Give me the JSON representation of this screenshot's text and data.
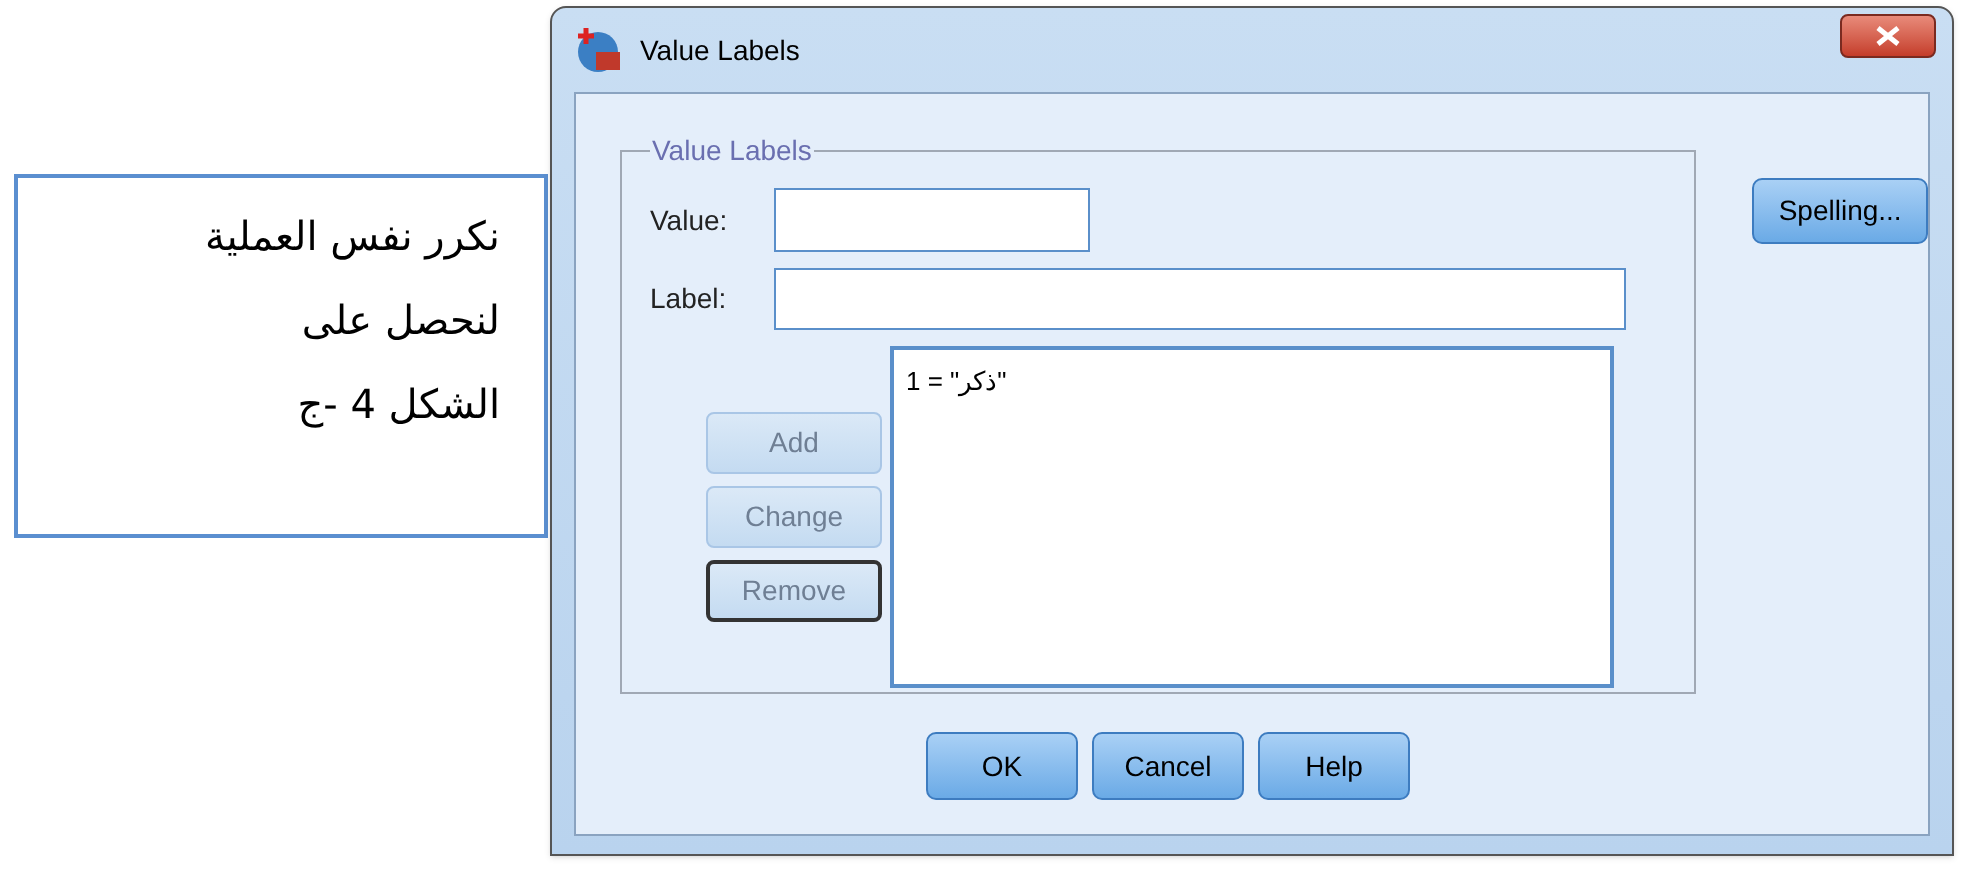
{
  "note": {
    "lines": [
      "نكرر نفس العملية",
      "لنحصل على",
      "الشكل 4 -ج"
    ]
  },
  "window": {
    "title": "Value Labels"
  },
  "group": {
    "title": "Value Labels",
    "value_field": {
      "label": "Value:"
    },
    "label_field": {
      "label": "Label:"
    },
    "buttons": [
      {
        "label": "Add",
        "disabled": true,
        "focused": false
      },
      {
        "label": "Change",
        "disabled": true,
        "focused": false
      },
      {
        "label": "Remove",
        "disabled": true,
        "focused": true
      }
    ],
    "list_items": [
      {
        "text": "1 = \"ذكر\"",
        "selected": false
      }
    ]
  },
  "spelling_button": "Spelling...",
  "footer_buttons": [
    {
      "label": "OK"
    },
    {
      "label": "Cancel"
    },
    {
      "label": "Help"
    }
  ]
}
